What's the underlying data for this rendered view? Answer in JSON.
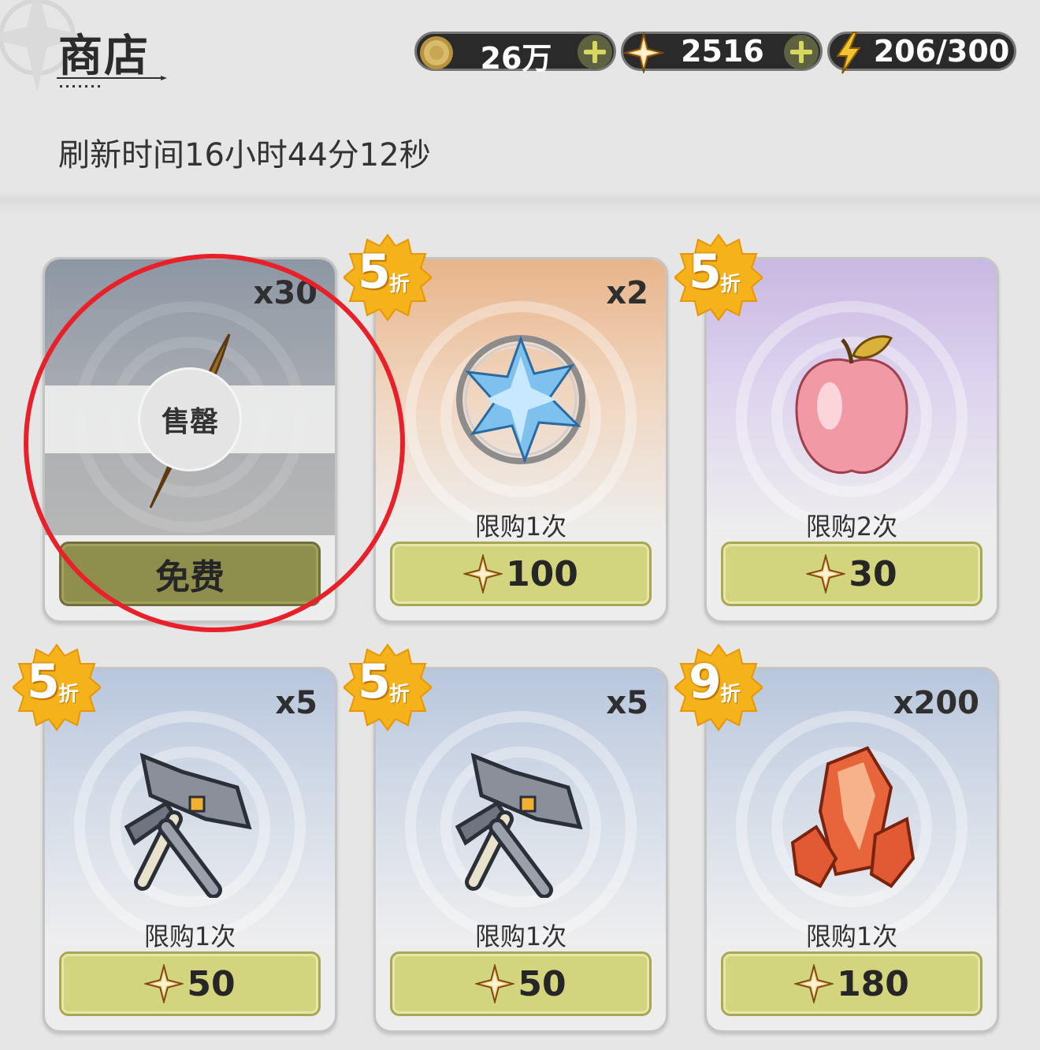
{
  "header": {
    "title": "商店",
    "refresh": "刷新时间16小时44分12秒"
  },
  "currencies": {
    "coins": {
      "value": "26万",
      "icon": "coin-icon"
    },
    "stars": {
      "value": "2516",
      "icon": "star-gem-icon"
    },
    "stamina": {
      "value": "206/300",
      "icon": "lightning-icon"
    }
  },
  "items": [
    {
      "name": "feather",
      "qty": "x30",
      "limit": "",
      "price": "免费",
      "sold_label": "售罄",
      "sold_out": true
    },
    {
      "name": "crystal-ore",
      "qty": "x2",
      "limit": "限购1次",
      "price": "100",
      "discount": "5",
      "discount_unit": "折"
    },
    {
      "name": "apple",
      "qty": "",
      "limit": "限购2次",
      "price": "30",
      "discount": "5",
      "discount_unit": "折"
    },
    {
      "name": "hammer",
      "qty": "x5",
      "limit": "限购1次",
      "price": "50",
      "discount": "5",
      "discount_unit": "折"
    },
    {
      "name": "hammer",
      "qty": "x5",
      "limit": "限购1次",
      "price": "50",
      "discount": "5",
      "discount_unit": "折"
    },
    {
      "name": "red-crystal",
      "qty": "x200",
      "limit": "限购1次",
      "price": "180",
      "discount": "9",
      "discount_unit": "折"
    }
  ],
  "colors": {
    "buy_button": "#d3d57e",
    "highlight_circle": "#e8202a",
    "badge": "#f5b21b"
  }
}
